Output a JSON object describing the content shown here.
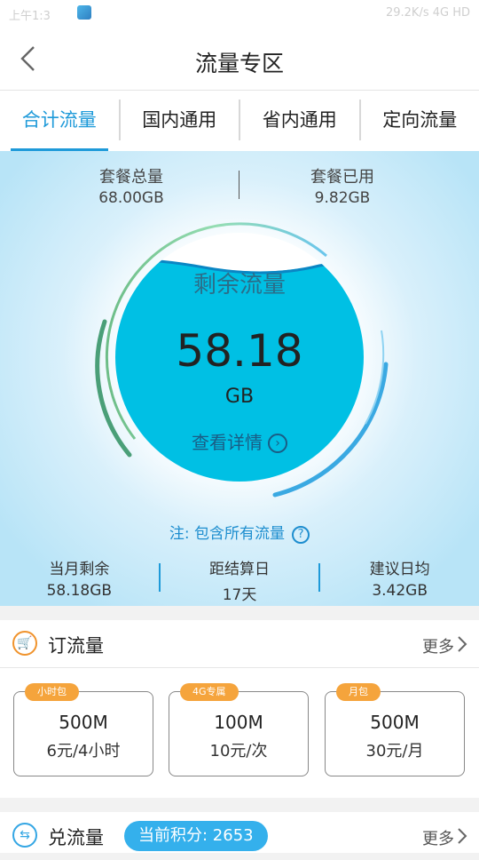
{
  "status_bar": {
    "left_text": "上午1:3",
    "right_text": "29.2K/s  4G HD"
  },
  "header": {
    "title": "流量专区"
  },
  "tabs": [
    {
      "label": "合计流量",
      "active": true
    },
    {
      "label": "国内通用",
      "active": false
    },
    {
      "label": "省内通用",
      "active": false
    },
    {
      "label": "定向流量",
      "active": false
    }
  ],
  "package": {
    "total_label": "套餐总量",
    "total_value": "68.00GB",
    "used_label": "套餐已用",
    "used_value": "9.82GB"
  },
  "gauge": {
    "label": "剩余流量",
    "value": "58.18",
    "unit": "GB",
    "detail_link": "查看详情",
    "remaining_fraction": 0.856
  },
  "note": {
    "text": "注: 包含所有流量"
  },
  "stats": [
    {
      "label": "当月剩余",
      "value": "58.18GB"
    },
    {
      "label": "距结算日",
      "value": "17天"
    },
    {
      "label": "建议日均",
      "value": "3.42GB"
    }
  ],
  "order_section": {
    "title": "订流量",
    "more": "更多",
    "cards": [
      {
        "tag": "小时包",
        "amount": "500M",
        "price": "6元/4小时"
      },
      {
        "tag": "4G专属",
        "amount": "100M",
        "price": "10元/次"
      },
      {
        "tag": "月包",
        "amount": "500M",
        "price": "30元/月"
      }
    ]
  },
  "exchange_section": {
    "title": "兑流量",
    "points": "当前积分: 2653",
    "more": "更多"
  },
  "colors": {
    "accent": "#1e9ad9",
    "water": "#00c0e4",
    "orange": "#f0932c"
  }
}
